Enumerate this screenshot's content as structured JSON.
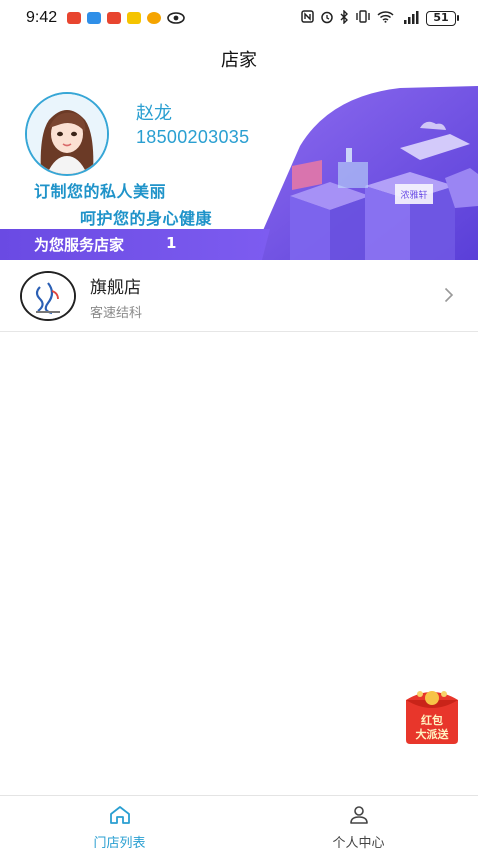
{
  "status_bar": {
    "time": "9:42",
    "battery": "51"
  },
  "header": {
    "title": "店家"
  },
  "banner": {
    "user_name": "赵龙",
    "user_phone": "18500203035",
    "slogan_line1": "订制您的私人美丽",
    "slogan_line2": "呵护您的身心健康",
    "served_label": "为您服务店家",
    "served_count": "1",
    "screen_text": "浓雅轩"
  },
  "stores": [
    {
      "name": "旗舰店",
      "subtitle": "客速结科"
    }
  ],
  "floating": {
    "red_packet_line1": "红包",
    "red_packet_line2": "大派送"
  },
  "tabbar": {
    "tabs": [
      {
        "label": "门店列表",
        "icon": "home-icon",
        "active": true
      },
      {
        "label": "个人中心",
        "icon": "user-icon",
        "active": false
      }
    ]
  },
  "colors": {
    "accent": "#2a9fd1",
    "banner_purple": "#6b4de6",
    "banner_bar": "#7a55e8"
  }
}
